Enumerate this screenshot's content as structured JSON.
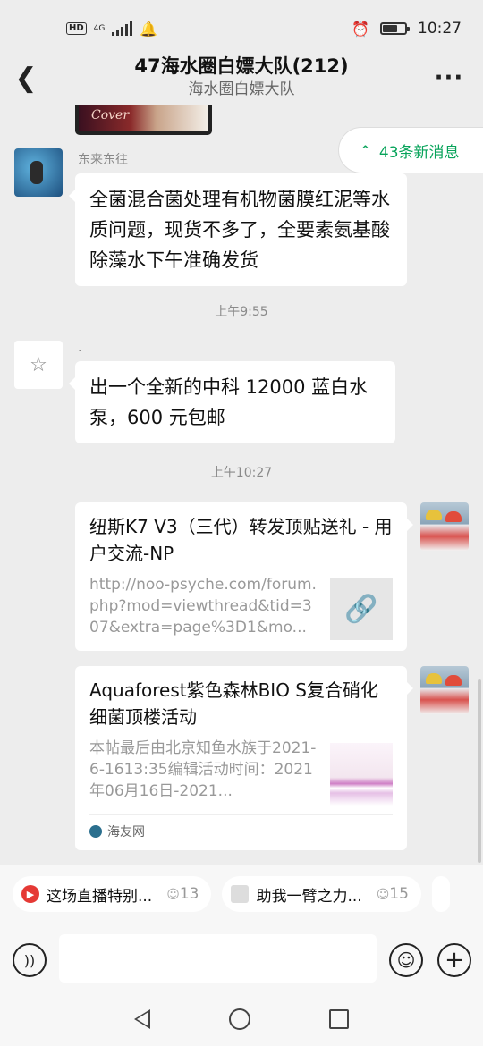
{
  "status_bar": {
    "hd": "HD",
    "network": "4G",
    "time": "10:27"
  },
  "header": {
    "title": "47海水圈白嫖大队(212)",
    "subtitle": "海水圈白嫖大队",
    "back_icon": "back-arrow-icon",
    "more_icon": "more-icon"
  },
  "partial_image_text": "Cover",
  "new_messages": {
    "label": "43条新消息",
    "color": "#07a35a"
  },
  "messages": [
    {
      "sender": "东来东往",
      "text": "全菌混合菌处理有机物菌膜红泥等水质问题，现货不多了，全要素氨基酸除藻水下午准确发货"
    },
    {
      "sender": ".",
      "text": "出一个全新的中科 12000 蓝白水泵，600 元包邮"
    }
  ],
  "timestamps": [
    "上午9:55",
    "上午10:27"
  ],
  "cards": [
    {
      "title": "纽斯K7 V3（三代）转发顶贴送礼 - 用户交流-NP",
      "desc": "http://noo-psyche.com/forum.php?mod=viewthread&tid=307&extra=page%3D1&mo..."
    },
    {
      "title": "Aquaforest紫色森林BIO S复合硝化细菌顶楼活动",
      "desc": "本帖最后由北京知鱼水族于2021-6-1613:35编辑活动时间：2021年06月16日-2021...",
      "source": "海友网"
    }
  ],
  "chips": [
    {
      "label": "这场直播特别...",
      "count": "13"
    },
    {
      "label": "助我一臂之力...",
      "count": "15"
    }
  ],
  "input": {
    "placeholder": ""
  }
}
